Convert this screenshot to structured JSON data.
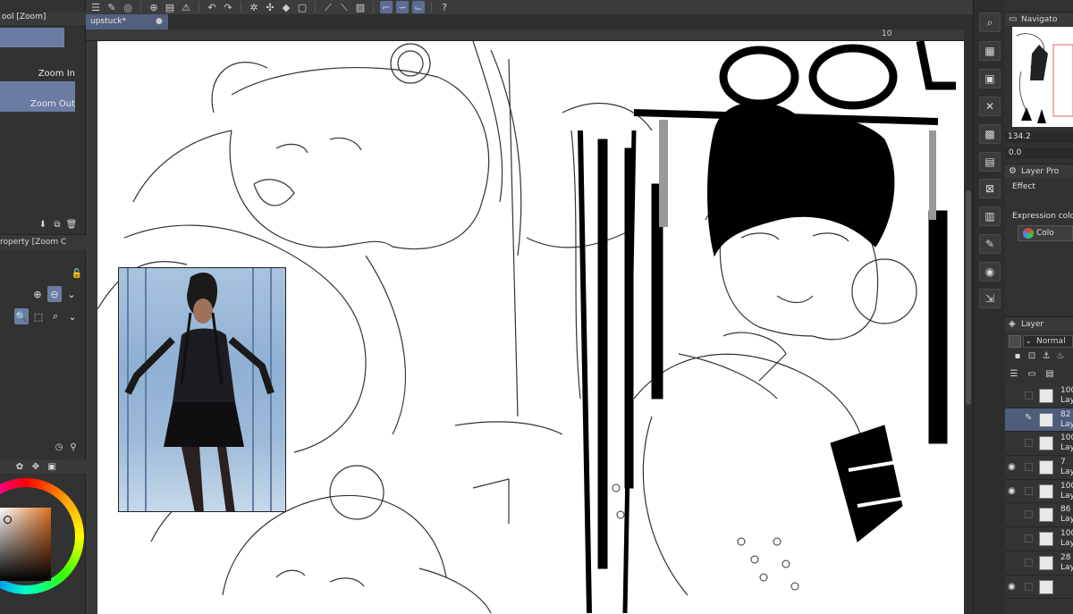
{
  "app": {
    "accent": "#6a7ca1",
    "canvas_bg": "#ffffff"
  },
  "toolbar": {
    "icons": [
      "menu-icon",
      "pen-settings-icon",
      "spiral-icon",
      "new-file-icon",
      "open-folder-icon",
      "warning-icon",
      "undo-icon",
      "redo-icon",
      "gear-icon",
      "snap-icon",
      "grid-icon",
      "ruler-icon",
      "snap-special-icon",
      "help-icon"
    ]
  },
  "tool_panel": {
    "title": "ool [Zoom]",
    "zoom_in": "Zoom In",
    "zoom_out": "Zoom Out",
    "property_title": "roperty [Zoom C"
  },
  "document": {
    "tab_label": "upstuck*",
    "ruler_mark": "10"
  },
  "navigator": {
    "title": "Navigato",
    "zoom_value": "134.2",
    "angle_value": "0.0"
  },
  "layer_property": {
    "title": "Layer Pro",
    "effect_label": "Effect",
    "expression_label": "Expression colo",
    "expression_value": "Colo"
  },
  "layer_panel": {
    "title": "Layer",
    "blend_mode": "Normal",
    "layers": [
      {
        "opacity": "100",
        "name": "Lay",
        "visible": false,
        "selected": false,
        "pen": false
      },
      {
        "opacity": "82",
        "name": "Lay",
        "visible": false,
        "selected": true,
        "pen": true
      },
      {
        "opacity": "100",
        "name": "Lay",
        "visible": false,
        "selected": false,
        "pen": false
      },
      {
        "opacity": "7",
        "name": "Lay",
        "visible": true,
        "selected": false,
        "pen": false
      },
      {
        "opacity": "100",
        "name": "Lay",
        "visible": true,
        "selected": false,
        "pen": false
      },
      {
        "opacity": "86",
        "name": "Lay",
        "visible": false,
        "selected": false,
        "pen": false
      },
      {
        "opacity": "100",
        "name": "Lay",
        "visible": false,
        "selected": false,
        "pen": false
      },
      {
        "opacity": "28",
        "name": "Lay",
        "visible": false,
        "selected": false,
        "pen": false
      },
      {
        "opacity": "",
        "name": "",
        "visible": true,
        "selected": false,
        "pen": false
      }
    ]
  }
}
